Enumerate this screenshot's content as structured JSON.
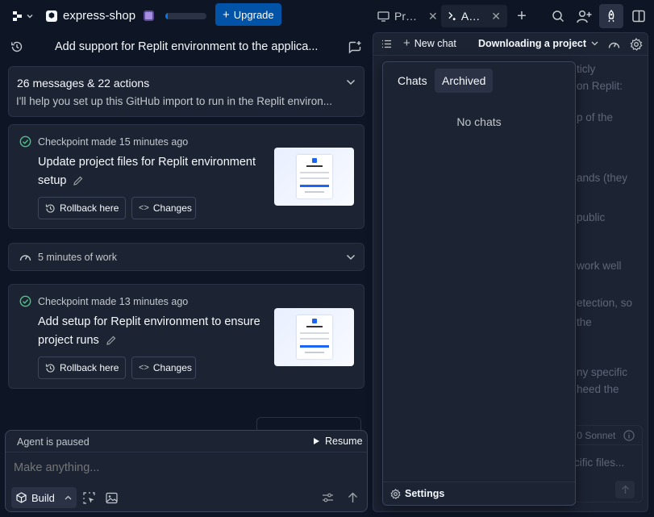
{
  "topbar": {
    "project_name": "express-shop",
    "upgrade_label": "Upgrade",
    "tabs": [
      {
        "label": "Pr…",
        "active": false
      },
      {
        "label": "A…",
        "active": true
      }
    ],
    "progress_fraction": 0.05
  },
  "thread": {
    "title": "Add support for Replit environment to the applica..."
  },
  "summary": {
    "count_label": "26 messages & 22 actions",
    "preview": "I'll help you set up this GitHub import to run in the Replit environ..."
  },
  "checkpoints": [
    {
      "status": "Checkpoint made 15 minutes ago",
      "title_line1": "Update project files for Replit environment",
      "title_line2": "setup",
      "rollback_label": "Rollback here",
      "changes_label": "Changes"
    },
    {
      "status": "Checkpoint made 13 minutes ago",
      "title_line1": "Add setup for Replit environment to ensure",
      "title_line2": "project runs",
      "rollback_label": "Rollback here",
      "changes_label": "Changes"
    }
  ],
  "work": {
    "label": "5 minutes of work"
  },
  "composer": {
    "paused_label": "Agent is paused",
    "resume_label": "Resume",
    "placeholder": "Make anything...",
    "mode_label": "Build"
  },
  "right_panel": {
    "new_chat_label": "New chat",
    "chat_title": "Downloading a project",
    "background_fragments": [
      "ticly",
      "on Replit:",
      "p of the",
      "ands (they",
      "public",
      "work well",
      "etection, so",
      "the",
      "ny specific",
      "heed the",
      ".0 Sonnet",
      "cific files..."
    ]
  },
  "chats_popup": {
    "tab_chats": "Chats",
    "tab_archived": "Archived",
    "empty_label": "No chats",
    "settings_label": "Settings"
  }
}
